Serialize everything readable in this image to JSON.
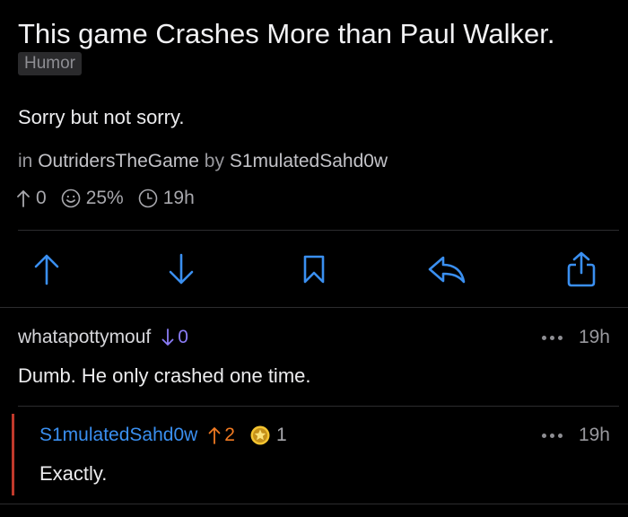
{
  "post": {
    "title": "This game Crashes More than Paul Walker.",
    "flair": "Humor",
    "body": "Sorry but not sorry.",
    "meta": {
      "in_label": "in",
      "subreddit": "OutridersTheGame",
      "by_label": "by",
      "author": "S1mulatedSahd0w"
    },
    "stats": {
      "score": "0",
      "upvote_ratio": "25%",
      "age": "19h"
    }
  },
  "actions": [
    {
      "name": "upvote",
      "icon": "arrow-up-icon"
    },
    {
      "name": "downvote",
      "icon": "arrow-down-icon"
    },
    {
      "name": "save",
      "icon": "bookmark-icon"
    },
    {
      "name": "reply",
      "icon": "reply-icon"
    },
    {
      "name": "share",
      "icon": "share-icon"
    }
  ],
  "comments": [
    {
      "author": "whatapottymouf",
      "vote_direction": "down",
      "score": "0",
      "age": "19h",
      "text": "Dumb. He only crashed one time."
    },
    {
      "author": "S1mulatedSahd0w",
      "vote_direction": "up",
      "score": "2",
      "award_count": "1",
      "age": "19h",
      "text": "Exactly."
    }
  ],
  "colors": {
    "background": "#000000",
    "accent_blue": "#3a8ff0",
    "downvote": "#8b7cf6",
    "upvote": "#f07a22",
    "op_author": "#3a8ff0",
    "reply_bar": "#c0392b"
  }
}
